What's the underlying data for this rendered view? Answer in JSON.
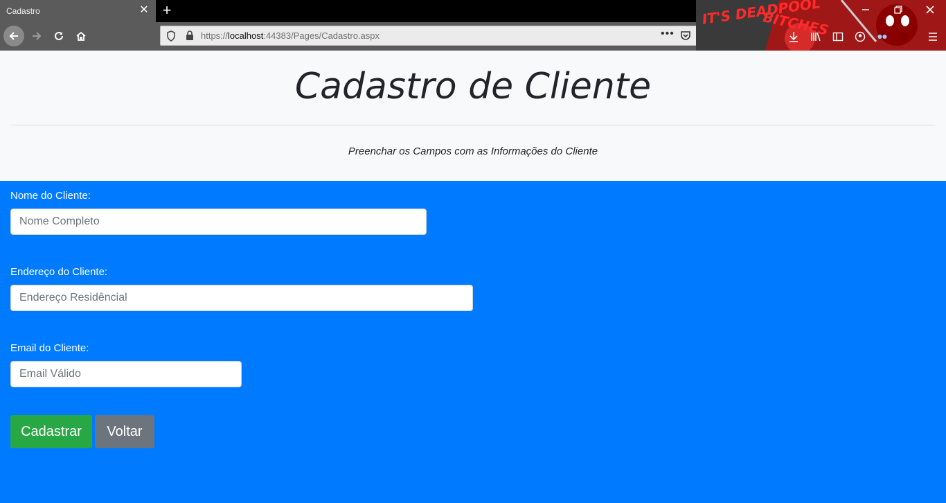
{
  "browser": {
    "tab_title": "Cadastro",
    "close_glyph": "✕",
    "new_tab_glyph": "+",
    "url_prefix": "https://",
    "url_host": "localhost",
    "url_rest": ":44383/Pages/Cadastro.aspx",
    "menu_dots": "•••",
    "theme_text_1": "IT'S DEADPOOL",
    "theme_text_2": "BITCHES"
  },
  "header": {
    "title": "Cadastro de Cliente",
    "subtitle": "Preenchar os Campos com as Informações do Cliente"
  },
  "form": {
    "name_label": "Nome do Cliente:",
    "name_placeholder": "Nome Completo",
    "address_label": "Endereço do Cliente:",
    "address_placeholder": "Endereço Residêncial",
    "email_label": "Email do Cliente:",
    "email_placeholder": "Email Válido",
    "submit_label": "Cadastrar",
    "back_label": "Voltar"
  },
  "colors": {
    "primary": "#007bff",
    "success": "#28a745",
    "secondary": "#6c757d",
    "jumbotron": "#f8f9fa"
  }
}
